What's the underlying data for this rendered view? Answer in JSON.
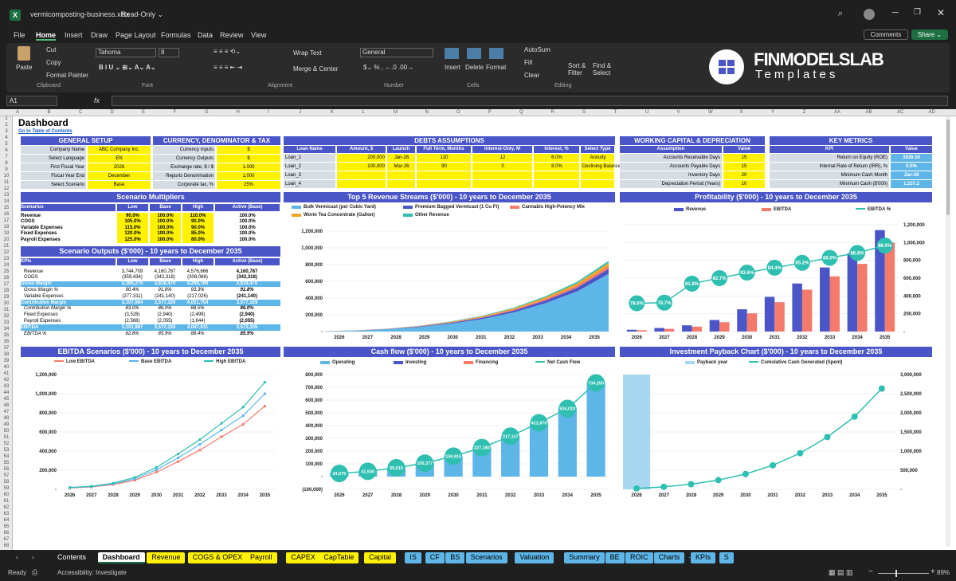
{
  "window": {
    "title": "vermicomposting-business.xlsx",
    "mode": "Read-Only ⌄"
  },
  "menu": [
    "File",
    "Home",
    "Insert",
    "Draw",
    "Page Layout",
    "Formulas",
    "Data",
    "Review",
    "View"
  ],
  "menu_right": {
    "comments": "Comments",
    "share": "Share ⌄"
  },
  "ribbon": {
    "paste": "Paste",
    "cut": "Cut",
    "copy": "Copy",
    "format_painter": "Format Painter",
    "font": "Tahoma",
    "size": "8",
    "wrap": "Wrap Text",
    "merge": "Merge & Center",
    "number_format": "General",
    "insert": "Insert",
    "delete": "Delete",
    "format": "Format",
    "autosum": "AutoSum",
    "fill": "Fill",
    "clear": "Clear",
    "sort": "Sort &\nFilter",
    "find": "Find &\nSelect",
    "groups": [
      "Clipboard",
      "Font",
      "Alignment",
      "Number",
      "Cells",
      "Editing"
    ]
  },
  "brand": {
    "name": "FINMODELSLAB",
    "sub": "Templates"
  },
  "formula_bar": {
    "cell": "A1",
    "fx": "fx"
  },
  "columns": [
    "A",
    "B",
    "C",
    "D",
    "E",
    "F",
    "G",
    "H",
    "I",
    "J",
    "K",
    "L",
    "M",
    "N",
    "O",
    "P",
    "Q",
    "R",
    "S",
    "T",
    "U",
    "V",
    "W",
    "X",
    "Y",
    "Z",
    "AA",
    "AB",
    "AC",
    "AD"
  ],
  "dashboard": {
    "title": "Dashboard",
    "link": "Go to Table of Contents"
  },
  "general_setup": {
    "title": "GENERAL SETUP",
    "rows": [
      [
        "Company Name",
        "ABC Company Inc."
      ],
      [
        "Select Language",
        "EN"
      ],
      [
        "First Fiscal Year",
        "2026"
      ],
      [
        "Fiscal Year End",
        "December"
      ],
      [
        "Select Scenario",
        "Base"
      ]
    ]
  },
  "currency": {
    "title": "CURRENCY, DENOMINATOR & TAX",
    "rows": [
      [
        "Currency Inputs",
        "$"
      ],
      [
        "Currency Outputs",
        "$"
      ],
      [
        "Exchange rate, $ / $",
        "1.000"
      ],
      [
        "Reports Denomination",
        "1,000"
      ],
      [
        "Corporate tax, %",
        "25%"
      ]
    ]
  },
  "debts": {
    "title": "DEBTS ASSUMPTIONS",
    "headers": [
      "Loan Name",
      "Amount, $",
      "Launch",
      "Full Term, Months",
      "Interest-Only, M",
      "Interest, %",
      "Select Type"
    ],
    "rows": [
      [
        "Loan_1",
        "200,000",
        "Jan-26",
        "120",
        "12",
        "6.0%",
        "Annuity"
      ],
      [
        "Loan_2",
        "100,000",
        "Mar-26",
        "90",
        "0",
        "8.0%",
        "Declining Balance"
      ],
      [
        "Loan_3",
        "",
        "",
        "",
        "",
        "",
        ""
      ],
      [
        "Loan_4",
        "",
        "",
        "",
        "",
        "",
        ""
      ]
    ]
  },
  "wc": {
    "title": "WORKING CAPITAL & DEPRECIATION",
    "headers": [
      "Assumption",
      "Value"
    ],
    "rows": [
      [
        "Accounts Receivable Days",
        "15"
      ],
      [
        "Accounts Payable Days",
        "15"
      ],
      [
        "Inventory Days",
        "20"
      ],
      [
        "Depreciation Period (Years)",
        "10"
      ]
    ]
  },
  "kpi": {
    "title": "KEY METRICS",
    "headers": [
      "KPI",
      "Value"
    ],
    "rows": [
      [
        "Return on Equity (ROE)",
        "3826.59"
      ],
      [
        "Internal Rate of Return (IRR), %",
        "0.0%"
      ],
      [
        "Minimum Cash Month",
        "Jan-26"
      ],
      [
        "Minimum Cash ($'000)",
        "1,237.2"
      ]
    ]
  },
  "multipliers": {
    "title": "Scenario Multipliers",
    "headers": [
      "Scenarios",
      "Low",
      "Base",
      "High",
      "Active (Base)"
    ],
    "rows": [
      [
        "Revenue",
        "90.0%",
        "100.0%",
        "110.0%",
        "100.0%"
      ],
      [
        "COGS",
        "105.0%",
        "100.0%",
        "90.0%",
        "100.0%"
      ],
      [
        "Variable Expenses",
        "115.0%",
        "100.0%",
        "90.0%",
        "100.0%"
      ],
      [
        "Fixed Expenses",
        "120.0%",
        "100.0%",
        "85.0%",
        "100.0%"
      ],
      [
        "Payroll Expenses",
        "125.0%",
        "100.0%",
        "80.0%",
        "100.0%"
      ]
    ]
  },
  "outputs": {
    "title": "Scenario Outputs ($'000) - 10 years to December 2035",
    "headers": [
      "KPIs",
      "Low",
      "Base",
      "High",
      "Active (Base)"
    ],
    "rows": [
      [
        "Revenue",
        "3,744,709",
        "4,160,787",
        "4,576,866",
        "4,160,787",
        "n"
      ],
      [
        "COGS",
        "(359,434)",
        "(342,318)",
        "(308,086)",
        "(342,318)",
        "n"
      ],
      [
        "Gross Margin",
        "3,385,275",
        "3,818,470",
        "4,268,780",
        "3,818,470",
        "h"
      ],
      [
        "Gross Margin %",
        "90.4%",
        "91.8%",
        "93.3%",
        "91.8%",
        "i"
      ],
      [
        "Variable Expenses",
        "(277,311)",
        "(241,140)",
        "(217,026)",
        "(241,140)",
        "n"
      ],
      [
        "Contribution Margin",
        "3,107,964",
        "3,577,329",
        "4,051,754",
        "3,577,329",
        "h"
      ],
      [
        "Contribution Margin %",
        "83.0%",
        "86.0%",
        "88.5%",
        "86.0%",
        "i"
      ],
      [
        "Fixed Expenses",
        "(3,528)",
        "(2,940)",
        "(2,499)",
        "(2,940)",
        "n"
      ],
      [
        "Payroll Expenses",
        "(2,568)",
        "(2,055)",
        "(1,644)",
        "(2,055)",
        "n"
      ],
      [
        "EBITDA",
        "3,101,867",
        "3,572,335",
        "4,047,611",
        "3,572,335",
        "h"
      ],
      [
        "EBITDA %",
        "82.8%",
        "85.9%",
        "88.4%",
        "85.9%",
        "i"
      ]
    ]
  },
  "years": [
    "2026",
    "2027",
    "2028",
    "2029",
    "2030",
    "2031",
    "2032",
    "2033",
    "2034",
    "2035"
  ],
  "chart_data": [
    {
      "type": "area",
      "title": "Top 5 Revenue Streams ($'000) - 10 years to December 2035",
      "series": [
        {
          "name": "Bulk Vermicast (per Cubic Yard)",
          "color": "#5eb6e8",
          "values": [
            4000,
            12000,
            28000,
            55000,
            95000,
            150000,
            230000,
            340000,
            480000,
            690000
          ]
        },
        {
          "name": "Premium Bagged Vermicast (1 Cu Ft)",
          "color": "#4a55c7",
          "values": [
            500,
            1500,
            3000,
            6000,
            10000,
            15000,
            22000,
            32000,
            44000,
            60000
          ]
        },
        {
          "name": "Cannabis High-Potency Mix",
          "color": "#f47a6b",
          "values": [
            300,
            800,
            1800,
            3500,
            6000,
            9000,
            13000,
            19000,
            26000,
            35000
          ]
        },
        {
          "name": "Worm Tea Concentrate (Gallon)",
          "color": "#f5a623",
          "values": [
            300,
            800,
            1800,
            3500,
            6000,
            9000,
            13000,
            19000,
            26000,
            35000
          ]
        },
        {
          "name": "Other Revenue",
          "color": "#2ebfb0",
          "values": [
            200,
            500,
            1200,
            2500,
            4000,
            6000,
            9000,
            13000,
            18000,
            24000
          ]
        }
      ],
      "yticks": [
        "-",
        "200,000",
        "400,000",
        "600,000",
        "800,000",
        "1,000,000",
        "1,200,000"
      ],
      "ylim": [
        0,
        1200000
      ]
    },
    {
      "type": "bar",
      "title": "Profitability ($'000) - 10 years to December 2035",
      "series": [
        {
          "name": "Revenue",
          "color": "#4a55c7",
          "values": [
            20000,
            40000,
            70000,
            130000,
            250000,
            390000,
            540000,
            720000,
            880000,
            1140000
          ]
        },
        {
          "name": "EBITDA",
          "color": "#f47a6b",
          "values": [
            15000,
            30000,
            55000,
            105000,
            205000,
            330000,
            470000,
            620000,
            760000,
            1000000
          ]
        },
        {
          "name": "EBITDA %",
          "color": "#2ebfb0",
          "values": [
            78.6,
            78.7,
            81.8,
            82.7,
            83.6,
            84.4,
            85.2,
            86.0,
            86.8,
            88.0
          ],
          "labels": [
            "78.6%",
            "78.7%",
            "81.8%",
            "82.7%",
            "83.6%",
            "84.4%",
            "85.2%",
            "86.0%",
            "86.8%",
            "88.0%"
          ]
        }
      ],
      "yticks": [
        "-",
        "200,000",
        "400,000",
        "600,000",
        "800,000",
        "1,000,000",
        "1,200,000"
      ],
      "ylim": [
        0,
        1200000
      ]
    },
    {
      "type": "line",
      "title": "EBITDA Scenarios ($'000) - 10 years to December 2035",
      "series": [
        {
          "name": "Low EBITDA",
          "color": "#f47a6b",
          "values": [
            15000,
            25000,
            50000,
            95000,
            180000,
            290000,
            410000,
            550000,
            680000,
            870000
          ]
        },
        {
          "name": "Base EBITDA",
          "color": "#5eb6e8",
          "values": [
            17000,
            29000,
            57000,
            110000,
            205000,
            330000,
            470000,
            620000,
            770000,
            1000000
          ]
        },
        {
          "name": "High EBITDA",
          "color": "#2ebfb0",
          "values": [
            20000,
            33000,
            65000,
            125000,
            230000,
            370000,
            520000,
            690000,
            860000,
            1120000
          ]
        }
      ],
      "yticks": [
        "-",
        "200,000",
        "400,000",
        "600,000",
        "800,000",
        "1,000,000",
        "1,200,000"
      ],
      "ylim": [
        0,
        1200000
      ]
    },
    {
      "type": "bar",
      "title": "Cash flow ($'000) - 10 years to December 2035",
      "series": [
        {
          "name": "Operating",
          "color": "#5eb6e8",
          "values": [
            30000,
            45000,
            72000,
            110000,
            165000,
            230000,
            320000,
            420000,
            540000,
            740000
          ]
        },
        {
          "name": "Investing",
          "color": "#4a55c7",
          "values": [
            0,
            0,
            0,
            0,
            0,
            0,
            0,
            0,
            0,
            0
          ]
        },
        {
          "name": "Financing",
          "color": "#f47a6b",
          "values": [
            0,
            0,
            0,
            0,
            0,
            0,
            0,
            0,
            0,
            0
          ]
        },
        {
          "name": "Net Cash Flow",
          "color": "#2ebfb0",
          "values": [
            24675,
            41500,
            69515,
            105377,
            159915,
            227180,
            317117,
            421670,
            534010,
            734250
          ],
          "labels": [
            "24,675",
            "41,500",
            "69,515",
            "105,377",
            "159,915",
            "227,180",
            "317,117",
            "421,670",
            "534,010",
            "734,250"
          ]
        }
      ],
      "yticks": [
        "(100,000)",
        "-",
        "100,000",
        "200,000",
        "300,000",
        "400,000",
        "500,000",
        "600,000",
        "700,000",
        "800,000"
      ],
      "ylim": [
        -100000,
        800000
      ]
    },
    {
      "type": "line",
      "title": "Investment Payback Chart ($'000) - 10 years to December 2035",
      "series": [
        {
          "name": "Payback year",
          "color": "#a8d8f0",
          "values": [
            1,
            0,
            0,
            0,
            0,
            0,
            0,
            0,
            0,
            0
          ]
        },
        {
          "name": "Cumulative Cash Generated (Spent)",
          "color": "#2ebfb0",
          "values": [
            24675,
            66175,
            135690,
            241067,
            400982,
            628162,
            945279,
            1366949,
            1900959,
            2635209
          ]
        }
      ],
      "yticks": [
        "-",
        "500,000",
        "1,000,000",
        "1,500,000",
        "2,000,000",
        "2,500,000",
        "3,000,000"
      ],
      "ylim": [
        0,
        3000000
      ]
    }
  ],
  "sheet_tabs": [
    {
      "l": "Contents",
      "c": "#1f1f1f",
      "t": "#fff"
    },
    {
      "l": "Dashboard",
      "c": "#fff",
      "t": "#000"
    },
    {
      "l": "Revenue",
      "c": "#fff200",
      "t": "#000"
    },
    {
      "l": "COGS & OPEX",
      "c": "#fff200",
      "t": "#000"
    },
    {
      "l": "Payroll",
      "c": "#fff200",
      "t": "#000"
    },
    {
      "l": "CAPEX",
      "c": "#fff200",
      "t": "#000"
    },
    {
      "l": "CapTable",
      "c": "#fff200",
      "t": "#000"
    },
    {
      "l": "Capital",
      "c": "#fff200",
      "t": "#000"
    },
    {
      "l": "IS",
      "c": "#5eb6e8",
      "t": "#000"
    },
    {
      "l": "CF",
      "c": "#5eb6e8",
      "t": "#000"
    },
    {
      "l": "BS",
      "c": "#5eb6e8",
      "t": "#000"
    },
    {
      "l": "Scenarios",
      "c": "#5eb6e8",
      "t": "#000"
    },
    {
      "l": "Valuation",
      "c": "#5eb6e8",
      "t": "#000"
    },
    {
      "l": "Summary",
      "c": "#5eb6e8",
      "t": "#000"
    },
    {
      "l": "BE",
      "c": "#5eb6e8",
      "t": "#000"
    },
    {
      "l": "ROIC",
      "c": "#5eb6e8",
      "t": "#000"
    },
    {
      "l": "Charts",
      "c": "#5eb6e8",
      "t": "#000"
    },
    {
      "l": "KPIs",
      "c": "#5eb6e8",
      "t": "#000"
    },
    {
      "l": "S",
      "c": "#5eb6e8",
      "t": "#000"
    }
  ],
  "status": {
    "ready": "Ready",
    "access": "Accessibility: Investigate",
    "zoom": "89%"
  }
}
